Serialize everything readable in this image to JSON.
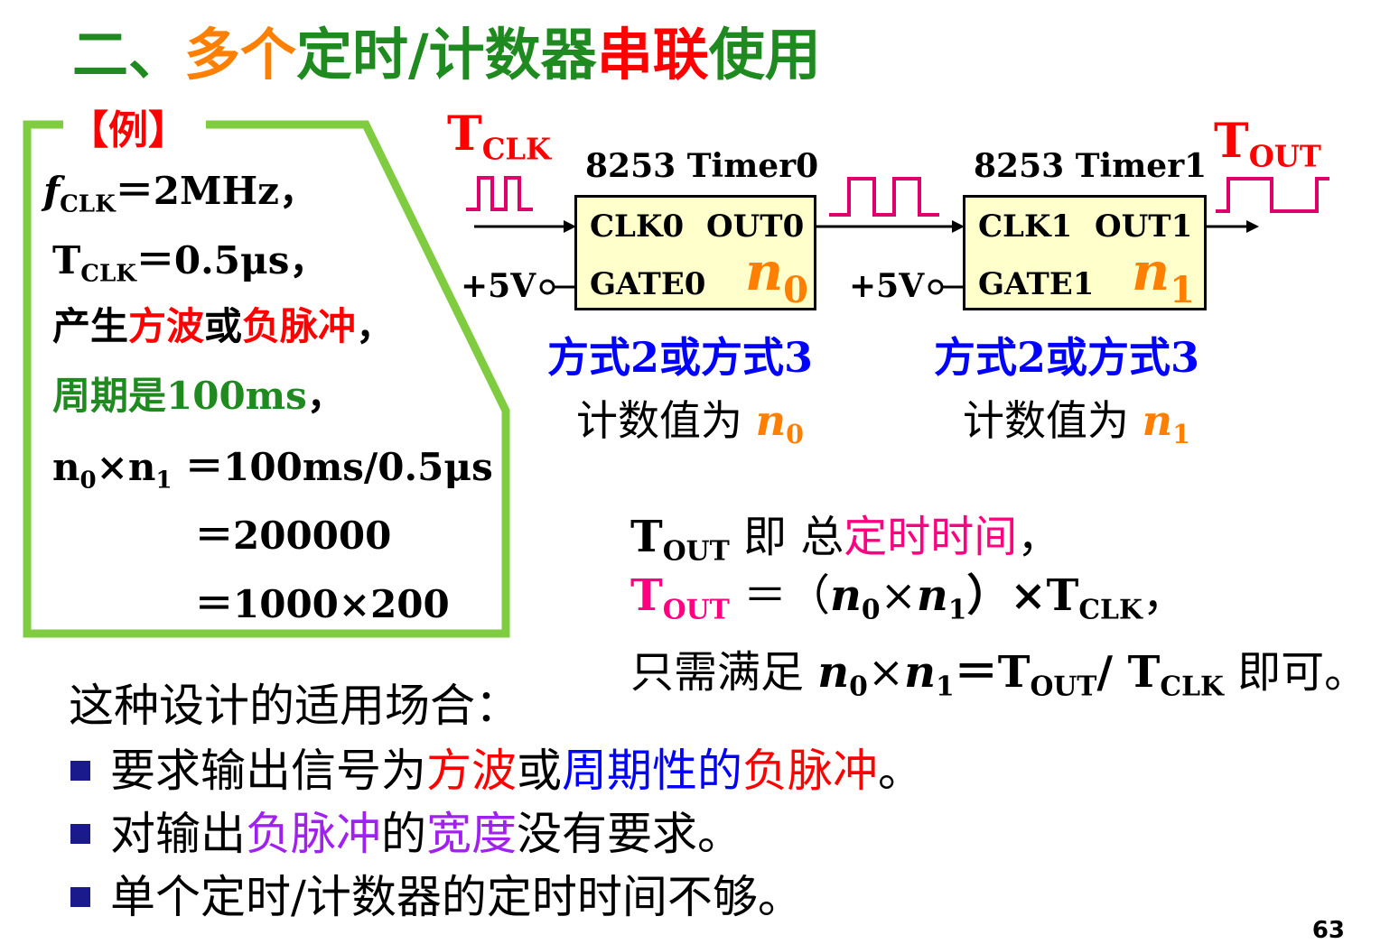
{
  "title": {
    "part1": "二、",
    "part2": "多个",
    "part3": "定时/计数器",
    "part4": "串联",
    "part5": "使用"
  },
  "example": {
    "label": "【例】",
    "fclk_sym": "f",
    "fclk_sub": "CLK",
    "fclk_val": "＝2MHz，",
    "tclk_sym": "T",
    "tclk_sub": "CLK",
    "tclk_val": "＝0.5μs，",
    "line3_a": "产生",
    "line3_b": "方波",
    "line3_c": "或",
    "line3_d": "负脉冲",
    "line3_e": "，",
    "line4_a": "周期是",
    "line4_b": "100ms",
    "line4_c": "，",
    "line5_n": "n",
    "line5_s0": "0",
    "line5_x": "×",
    "line5_s1": "1",
    "line5_rest": " ＝100ms/0.5μs",
    "line6": "＝200000",
    "line7": "＝1000×200"
  },
  "diagram": {
    "tclk_T": "T",
    "tclk_sub": "CLK",
    "tout_T": "T",
    "tout_sub": "OUT",
    "timer0_label": "8253 Timer0",
    "timer1_label": "8253 Timer1",
    "chip0": {
      "clk": "CLK0",
      "out": "OUT0",
      "gate": "GATE0",
      "n": "n",
      "nsub": "0"
    },
    "chip1": {
      "clk": "CLK1",
      "out": "OUT1",
      "gate": "GATE1",
      "n": "n",
      "nsub": "1"
    },
    "vcc0": "+5V",
    "vcc1": "+5V",
    "mode0": "方式2或方式3",
    "mode1": "方式2或方式3",
    "count0_text": "计数值为 ",
    "count0_n": "n",
    "count0_sub": "0",
    "count1_text": "计数值为 ",
    "count1_n": "n",
    "count1_sub": "1",
    "colors": {
      "wave": "#e0006c",
      "chip_fill": "#ffffcc",
      "frame": "#7fcc40"
    }
  },
  "formulas": {
    "f1_T": "T",
    "f1_sub": "OUT",
    "f1_a": " 即 总",
    "f1_b": "定时时间",
    "f1_c": "，",
    "f2_T": "T",
    "f2_sub": "OUT",
    "f2_eq": " ＝（",
    "f2_n": "n",
    "f2_s0": "0",
    "f2_x": "×",
    "f2_s1": "1",
    "f2_close": "）×T",
    "f2_clk": "CLK",
    "f2_end": "，",
    "f3_a": "只需满足 ",
    "f3_n": "n",
    "f3_s0": "0",
    "f3_x": "×",
    "f3_s1": "1",
    "f3_eq": "＝T",
    "f3_out": "OUT",
    "f3_slash": "/ T",
    "f3_clk": "CLK",
    "f3_end": " 即可。"
  },
  "applicability": {
    "heading": "这种设计的适用场合：",
    "b1_a": "要求输出信号为",
    "b1_b": "方波",
    "b1_c": "或",
    "b1_d": "周期性的",
    "b1_e": "负脉冲",
    "b1_f": "。",
    "b2_a": "对输出",
    "b2_b": "负脉冲",
    "b2_c": "的",
    "b2_d": "宽度",
    "b2_e": "没有要求。",
    "b3": "单个定时/计数器的定时时间不够。"
  },
  "page_number": "63"
}
